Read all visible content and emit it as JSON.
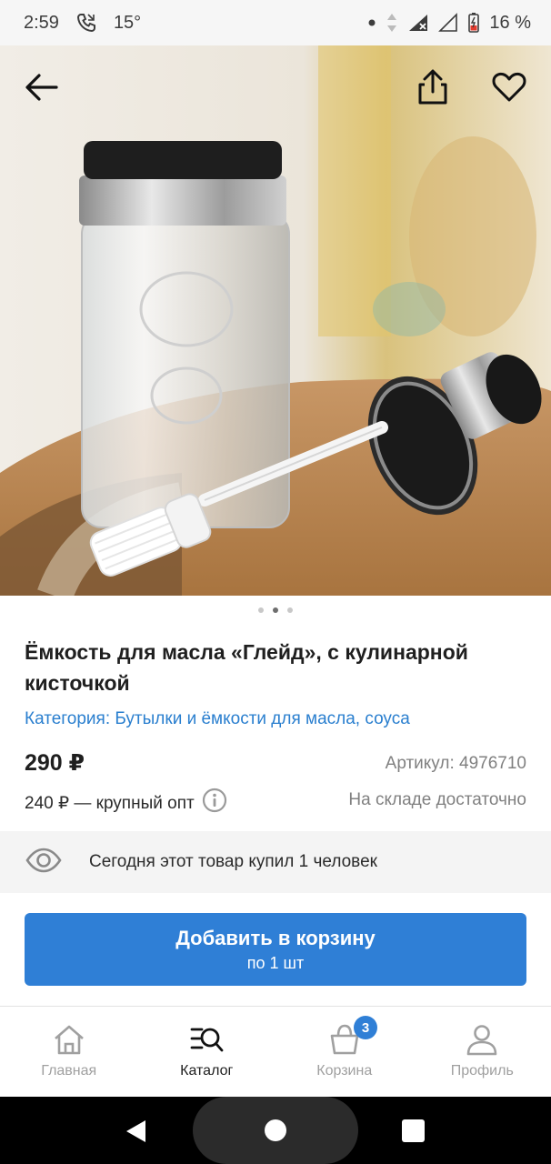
{
  "status_bar": {
    "time": "2:59",
    "temperature": "15°",
    "battery": "16 %",
    "icons": [
      "call-icon",
      "dot-icon",
      "data-arrows-icon",
      "signal-icon",
      "signal-empty-icon",
      "battery-icon"
    ]
  },
  "hero": {
    "image_subject": "glass oil jar with brush",
    "back_icon": "arrow-left-icon",
    "share_icon": "share-icon",
    "favorite_icon": "heart-icon",
    "slide_count": 3,
    "active_slide": 2
  },
  "product": {
    "title": "Ёмкость для масла «Глейд», с кулинарной кисточкой",
    "category": "Категория: Бутылки и ёмкости для масла, соуса",
    "price": "290 ₽",
    "sku": "Артикул: 4976710",
    "wholesale": "240 ₽ — крупный опт",
    "stock": "На складе достаточно"
  },
  "bought": {
    "icon": "eye-icon",
    "text": "Сегодня этот товар купил 1 человек"
  },
  "cart_button": {
    "label": "Добавить в корзину",
    "sublabel": "по 1 шт"
  },
  "bottom_nav": {
    "items": [
      {
        "label": "Главная",
        "icon": "home-icon"
      },
      {
        "label": "Каталог",
        "icon": "catalog-search-icon"
      },
      {
        "label": "Корзина",
        "icon": "basket-icon",
        "badge": "3"
      },
      {
        "label": "Профиль",
        "icon": "profile-icon"
      }
    ],
    "active": "Каталог"
  },
  "colors": {
    "accent": "#2f7fd6",
    "category_link": "#2a7fcf",
    "muted": "#808080"
  }
}
